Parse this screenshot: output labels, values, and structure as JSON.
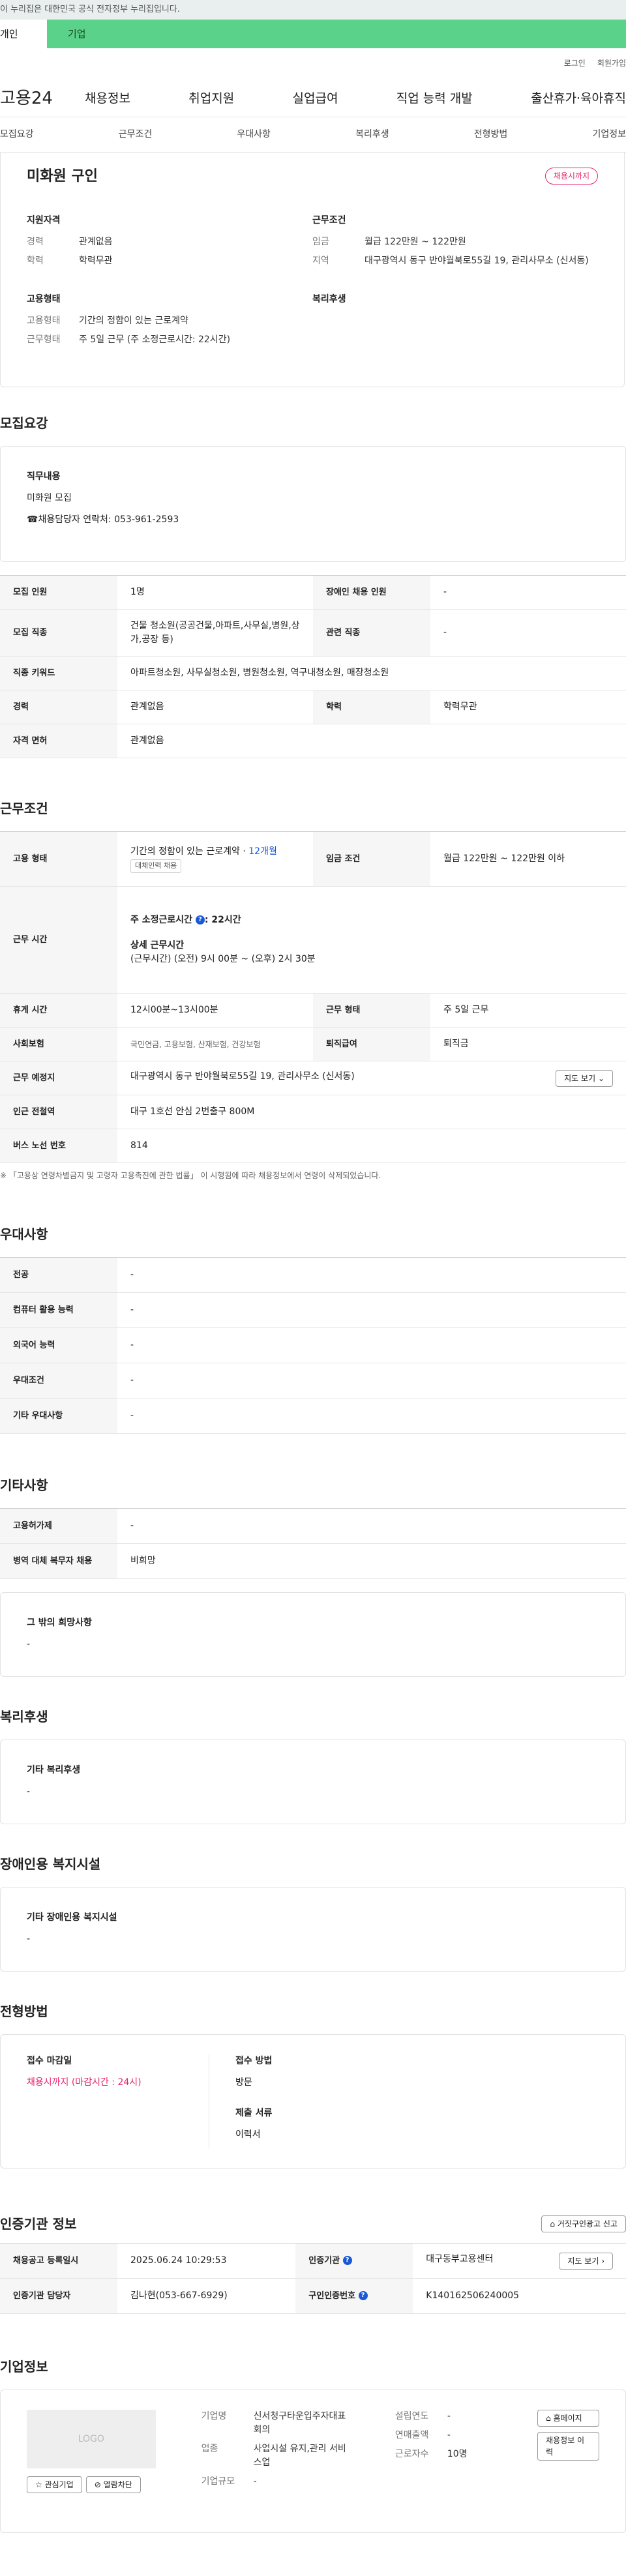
{
  "notice": "이 누리집은 대한민국 공식 전자정부 누리집입니다.",
  "topbar": {
    "personal": "개인",
    "company": "기업"
  },
  "util": [
    "로그인",
    "회원가입"
  ],
  "gnb": {
    "logo": "고용24",
    "menu": [
      "채용정보",
      "취업지원",
      "실업급여",
      "직업 능력 개발",
      "출산휴가·육아휴직"
    ]
  },
  "tabs": [
    "모집요강",
    "근무조건",
    "우대사항",
    "복리후생",
    "전형방법",
    "기업정보"
  ],
  "summary": {
    "title": "미화원 구인",
    "badge": "채용시까지",
    "qual": {
      "heading": "지원자격",
      "career_k": "경력",
      "career_v": "관계없음",
      "edu_k": "학력",
      "edu_v": "학력무관"
    },
    "cond": {
      "heading": "근무조건",
      "pay_k": "임금",
      "pay_v": "월급 122만원 ~ 122만원",
      "loc_k": "지역",
      "loc_v": "대구광역시 동구 반야월북로55길 19, 관리사무소 (신서동)"
    },
    "emp": {
      "heading": "고용형태",
      "type_k": "고용형태",
      "type_v": "기간의 정함이 있는 근로계약",
      "work_k": "근무형태",
      "work_v": "주 5일 근무 (주 소정근로시간: 22시간)"
    },
    "welfare": {
      "heading": "복리후생"
    }
  },
  "recruit": {
    "heading": "모집요강",
    "job_heading": "직무내용",
    "job_text": "미화원 모집",
    "contact": "☎채용담당자 연락처: 053-961-2593",
    "rows": [
      [
        "모집 인원",
        "1명",
        "장애인 채용 인원",
        "-"
      ],
      [
        "모집 직종",
        "건물 청소원(공공건물,아파트,사무실,병원,상가,공장 등)",
        "관련 직종",
        "-"
      ],
      [
        "직종 키워드",
        "아파트청소원, 사무실청소원, 병원청소원, 역구내청소원, 매장청소원"
      ],
      [
        "경력",
        "관계없음",
        "학력",
        "학력무관"
      ],
      [
        "자격 면허",
        "관계없음"
      ]
    ]
  },
  "work": {
    "heading": "근무조건",
    "emp_k": "고용 형태",
    "emp_v": "기간의 정함이 있는 근로계약 · ",
    "emp_months": "12개월",
    "emp_tag": "대체인력 채용",
    "pay_k": "임금 조건",
    "pay_v": "월급 122만원 ~ 122만원 이하",
    "time_k": "근무 시간",
    "time_week": "주 소정근로시간",
    "time_week_v": ": 22시간",
    "time_detail_h": "상세 근무시간",
    "time_detail_v": "(근무시간) (오전) 9시 00분 ~ (오후) 2시 30분",
    "rest_k": "휴게 시간",
    "rest_v": "12시00분~13시00분",
    "form_k": "근무 형태",
    "form_v": "주 5일 근무",
    "ins_k": "사회보험",
    "ins_v": "국민연금, 고용보험, 산재보험, 건강보험",
    "retire_k": "퇴직급여",
    "retire_v": "퇴직금",
    "place_k": "근무 예정지",
    "place_v": "대구광역시 동구 반야월북로55길 19, 관리사무소 (신서동)",
    "map_btn": "지도 보기",
    "station_k": "인근 전철역",
    "station_v": "대구 1호선 안심 2번출구 800M",
    "bus_k": "버스 노선 번호",
    "bus_v": "814",
    "note": "※ 「고용상 연령차별금지 및 고령자 고용촉진에 관한 법률」 이 시행됨에 따라 채용정보에서 연령이 삭제되었습니다."
  },
  "prefer": {
    "heading": "우대사항",
    "rows": [
      [
        "전공",
        "-"
      ],
      [
        "컴퓨터 활용 능력",
        "-"
      ],
      [
        "외국어 능력",
        "-"
      ],
      [
        "우대조건",
        "-"
      ],
      [
        "기타 우대사항",
        "-"
      ]
    ]
  },
  "etc": {
    "heading": "기타사항",
    "rows": [
      [
        "고용허가제",
        "-"
      ],
      [
        "병역 대체 복무자 채용",
        "비희망"
      ]
    ],
    "box_h": "그 밖의 희망사항",
    "box_v": "-"
  },
  "welfare": {
    "heading": "복리후생",
    "box_h": "기타 복리후생",
    "box_v": "-"
  },
  "disabled": {
    "heading": "장애인용 복지시설",
    "box_h": "기타 장애인용 복지시설",
    "box_v": "-"
  },
  "screening": {
    "heading": "전형방법",
    "deadline_h": "접수 마감일",
    "deadline_v": "채용시까지 (마감시간 : 24시)",
    "method_h": "접수 방법",
    "method_v": "방문",
    "docs_h": "제출 서류",
    "docs_v": "이력서"
  },
  "agency": {
    "heading": "인증기관 정보",
    "report_btn": "거짓구인광고 신고",
    "reg_k": "채용공고 등록일시",
    "reg_v": "2025.06.24 10:29:53",
    "org_k": "인증기관",
    "org_v": "대구동부고용센터",
    "map_btn": "지도 보기",
    "mgr_k": "인증기관 담당자",
    "mgr_v": "김나현(053-667-6929)",
    "no_k": "구인인증번호",
    "no_v": "K140162506240005"
  },
  "company": {
    "heading": "기업정보",
    "logo": "LOGO",
    "fav_btn": "관심기업",
    "block_btn": "열람차단",
    "name_k": "기업명",
    "name_v": "신서청구타운입주자대표회의",
    "type_k": "업종",
    "type_v": "사업시설 유지,관리 서비스업",
    "scale_k": "기업규모",
    "scale_v": "-",
    "year_k": "설립연도",
    "year_v": "-",
    "sales_k": "연매출액",
    "sales_v": "-",
    "emp_k": "근로자수",
    "emp_v": "10명",
    "home_btn": "홈페이지",
    "history_btn": "채용정보 이력"
  }
}
